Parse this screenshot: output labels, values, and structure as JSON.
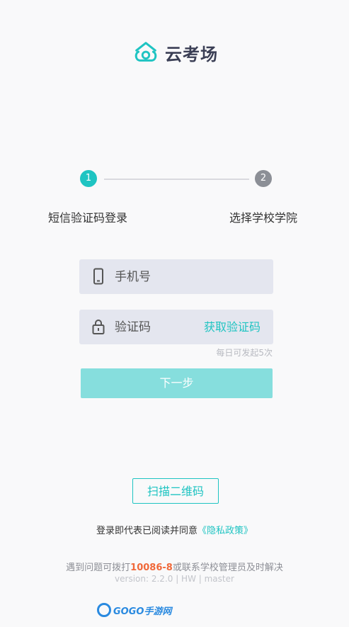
{
  "app": {
    "brand_name": "云考场",
    "accent_color": "#1fc4c2"
  },
  "steps": [
    {
      "number": "1",
      "label": "短信验证码登录",
      "active": true
    },
    {
      "number": "2",
      "label": "选择学校学院",
      "active": false
    }
  ],
  "form": {
    "phone": {
      "placeholder": "手机号",
      "icon": "phone-icon"
    },
    "code": {
      "placeholder": "验证码",
      "icon": "lock-icon",
      "get_code_label": "获取验证码"
    },
    "daily_limit": "每日可发起5次",
    "next_label": "下一步"
  },
  "scan_label": "扫描二维码",
  "agreement": {
    "prefix": "登录即代表已阅读并同意",
    "link": "《隐私政策》"
  },
  "help": {
    "prefix": "遇到问题可拨打",
    "phone": "10086-8",
    "suffix": "或联系学校管理员及时解决"
  },
  "version": "version: 2.2.0 | HW | master",
  "watermark": {
    "text": "GOGO手游网"
  }
}
